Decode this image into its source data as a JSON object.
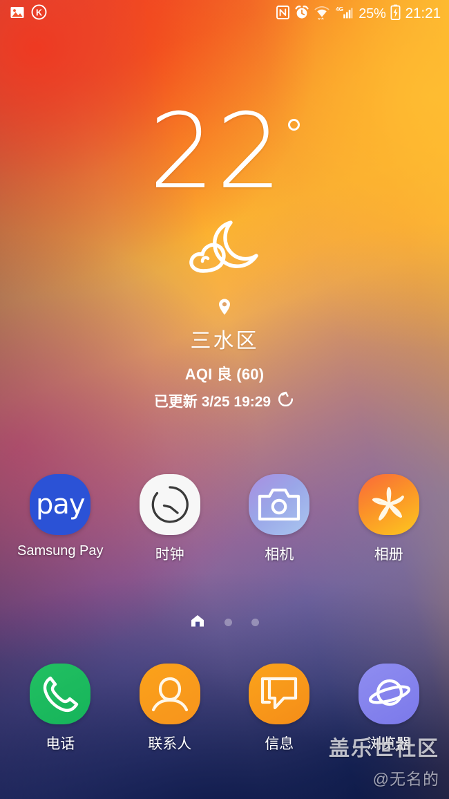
{
  "status_bar": {
    "left_icons": [
      {
        "name": "image-notification-icon",
        "glyph": "image"
      },
      {
        "name": "k-app-notification-icon",
        "glyph": "circled-k",
        "letter": "K"
      }
    ],
    "right_icons": [
      {
        "name": "nfc-icon",
        "glyph": "nfc"
      },
      {
        "name": "alarm-icon",
        "glyph": "alarm"
      },
      {
        "name": "wifi-icon",
        "glyph": "wifi"
      },
      {
        "name": "mobile-signal-icon",
        "glyph": "signal",
        "network": "4G"
      }
    ],
    "battery_percent": "25%",
    "battery_state": "charging",
    "clock": "21:21"
  },
  "weather": {
    "temperature": "22",
    "degree_symbol": "°",
    "condition_icon": "moon-cloud-icon",
    "location_icon": "location-pin-icon",
    "location": "三水区",
    "aqi": "AQI 良 (60)",
    "updated": "已更新 3/25 19:29",
    "refresh_icon": "refresh-icon"
  },
  "apps": {
    "row_top": [
      {
        "id": "samsung-pay",
        "label": "Samsung Pay",
        "icon": "samsung-pay-icon",
        "latin": true,
        "bg": "#2b52d6"
      },
      {
        "id": "clock",
        "label": "时钟",
        "icon": "clock-icon",
        "latin": false,
        "bg": "#f7f7f7"
      },
      {
        "id": "camera",
        "label": "相机",
        "icon": "camera-icon",
        "latin": false,
        "bg": "#9aa6e8"
      },
      {
        "id": "gallery",
        "label": "相册",
        "icon": "gallery-flower-icon",
        "latin": false,
        "bg": "#fb9328"
      }
    ],
    "row_dock": [
      {
        "id": "phone",
        "label": "电话",
        "icon": "phone-icon",
        "latin": false,
        "bg": "#16b45a"
      },
      {
        "id": "contacts",
        "label": "联系人",
        "icon": "contacts-icon",
        "latin": false,
        "bg": "#f7941d"
      },
      {
        "id": "messages",
        "label": "信息",
        "icon": "message-bubble-icon",
        "latin": false,
        "bg": "#f58d18"
      },
      {
        "id": "browser",
        "label": "浏览器",
        "icon": "saturn-browser-icon",
        "latin": false,
        "bg": "#7b79ea"
      }
    ],
    "pay_wordmark": "pay"
  },
  "page_indicator": {
    "pages": 3,
    "active_index": 0,
    "home_icon": "home-icon"
  },
  "watermark": {
    "title": "盖乐世社区",
    "handle": "@无名的"
  },
  "colors": {
    "wallpaper_top_left": "#f04a28",
    "wallpaper_top_right": "#fcb431",
    "wallpaper_mid": "#9e5f8e",
    "wallpaper_bottom": "#111d45",
    "status_text": "#ffffff"
  }
}
